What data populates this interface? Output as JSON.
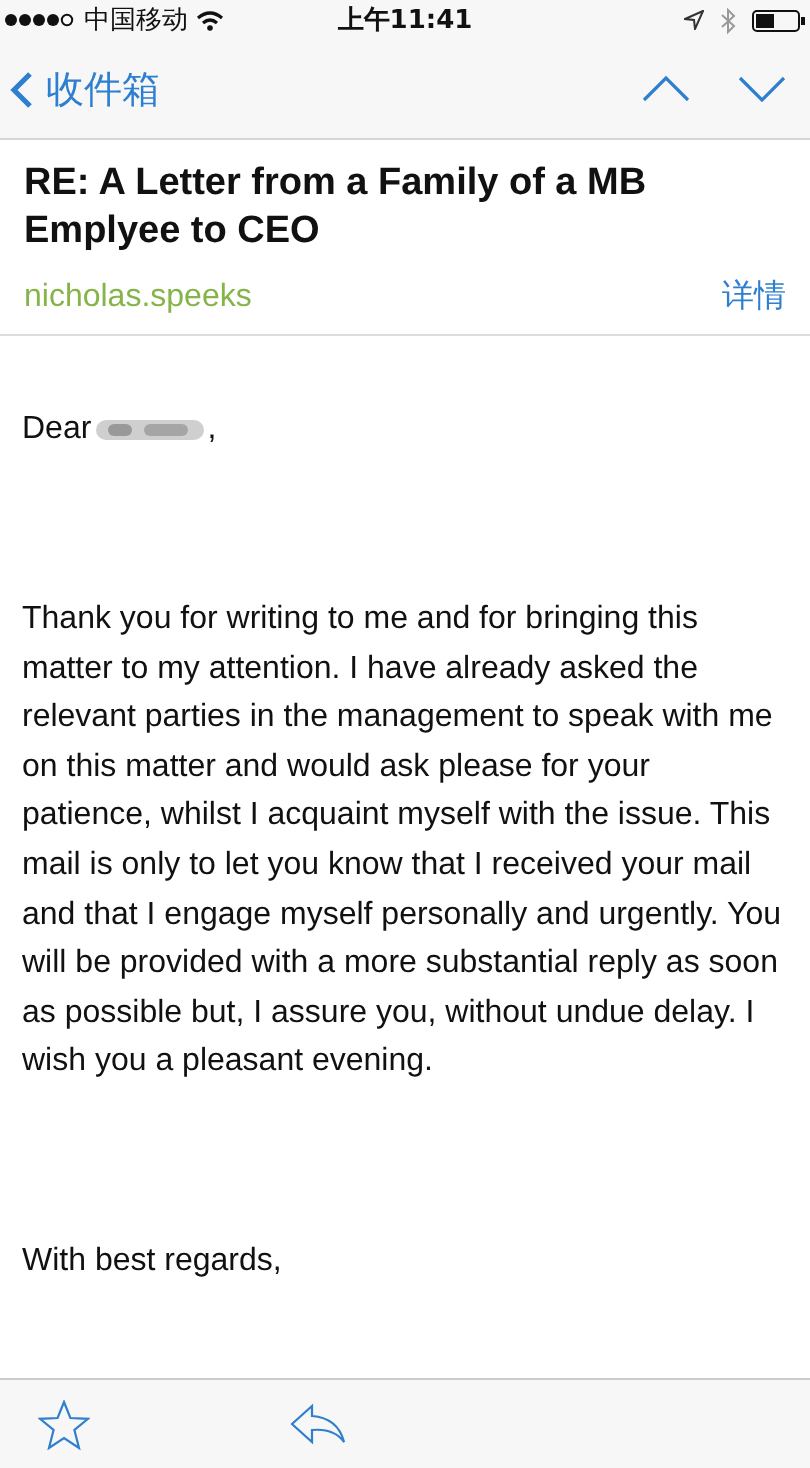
{
  "status_bar": {
    "carrier": "中国移动",
    "time": "上午11:41"
  },
  "nav": {
    "back_label": "收件箱"
  },
  "message": {
    "subject": "RE: A Letter from a Family of a MB Emplyee to CEO",
    "sender": "nicholas.speeks",
    "details_link": "详情",
    "greeting": "Dear",
    "greeting_end": ",",
    "body": "Thank you for writing to me and for bringing this matter to my attention. I have already asked the relevant parties in the management to speak with me on this matter and would ask please for your patience, whilst I acquaint myself with the issue. This mail is only to let you know that I received your mail and that I engage myself personally and urgently. You will be provided with a more substantial reply as soon as possible but, I assure you, without undue delay. I wish you a pleasant evening.",
    "closing": "With best regards,"
  }
}
